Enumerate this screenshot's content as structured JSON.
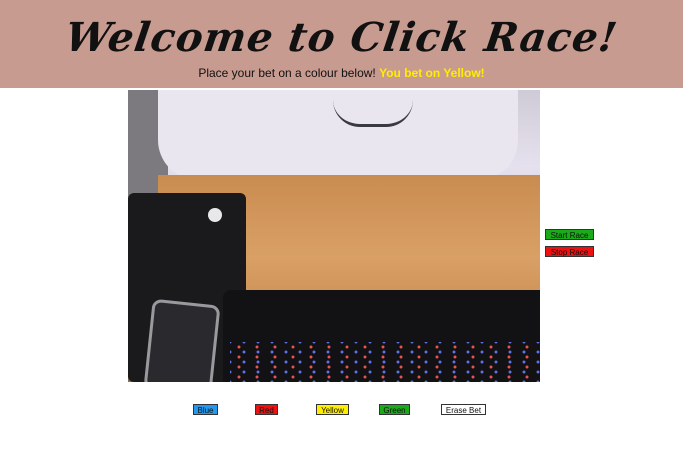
{
  "header": {
    "title": "Welcome to Click Race!",
    "subtitle": "Place your bet on a colour below!",
    "bet_status": "You bet on Yellow!"
  },
  "race_controls": {
    "start_label": "Start Race",
    "stop_label": "Stop Race"
  },
  "bet_buttons": {
    "blue": "Blue",
    "red": "Red",
    "yellow": "Yellow",
    "green": "Green",
    "erase": "Erase Bet"
  },
  "colors": {
    "header_bg": "#c79b90",
    "bet_status": "#ffee00",
    "blue": "#2299ee",
    "red": "#ee1111",
    "yellow": "#ffee00",
    "green": "#1aaa1a"
  }
}
